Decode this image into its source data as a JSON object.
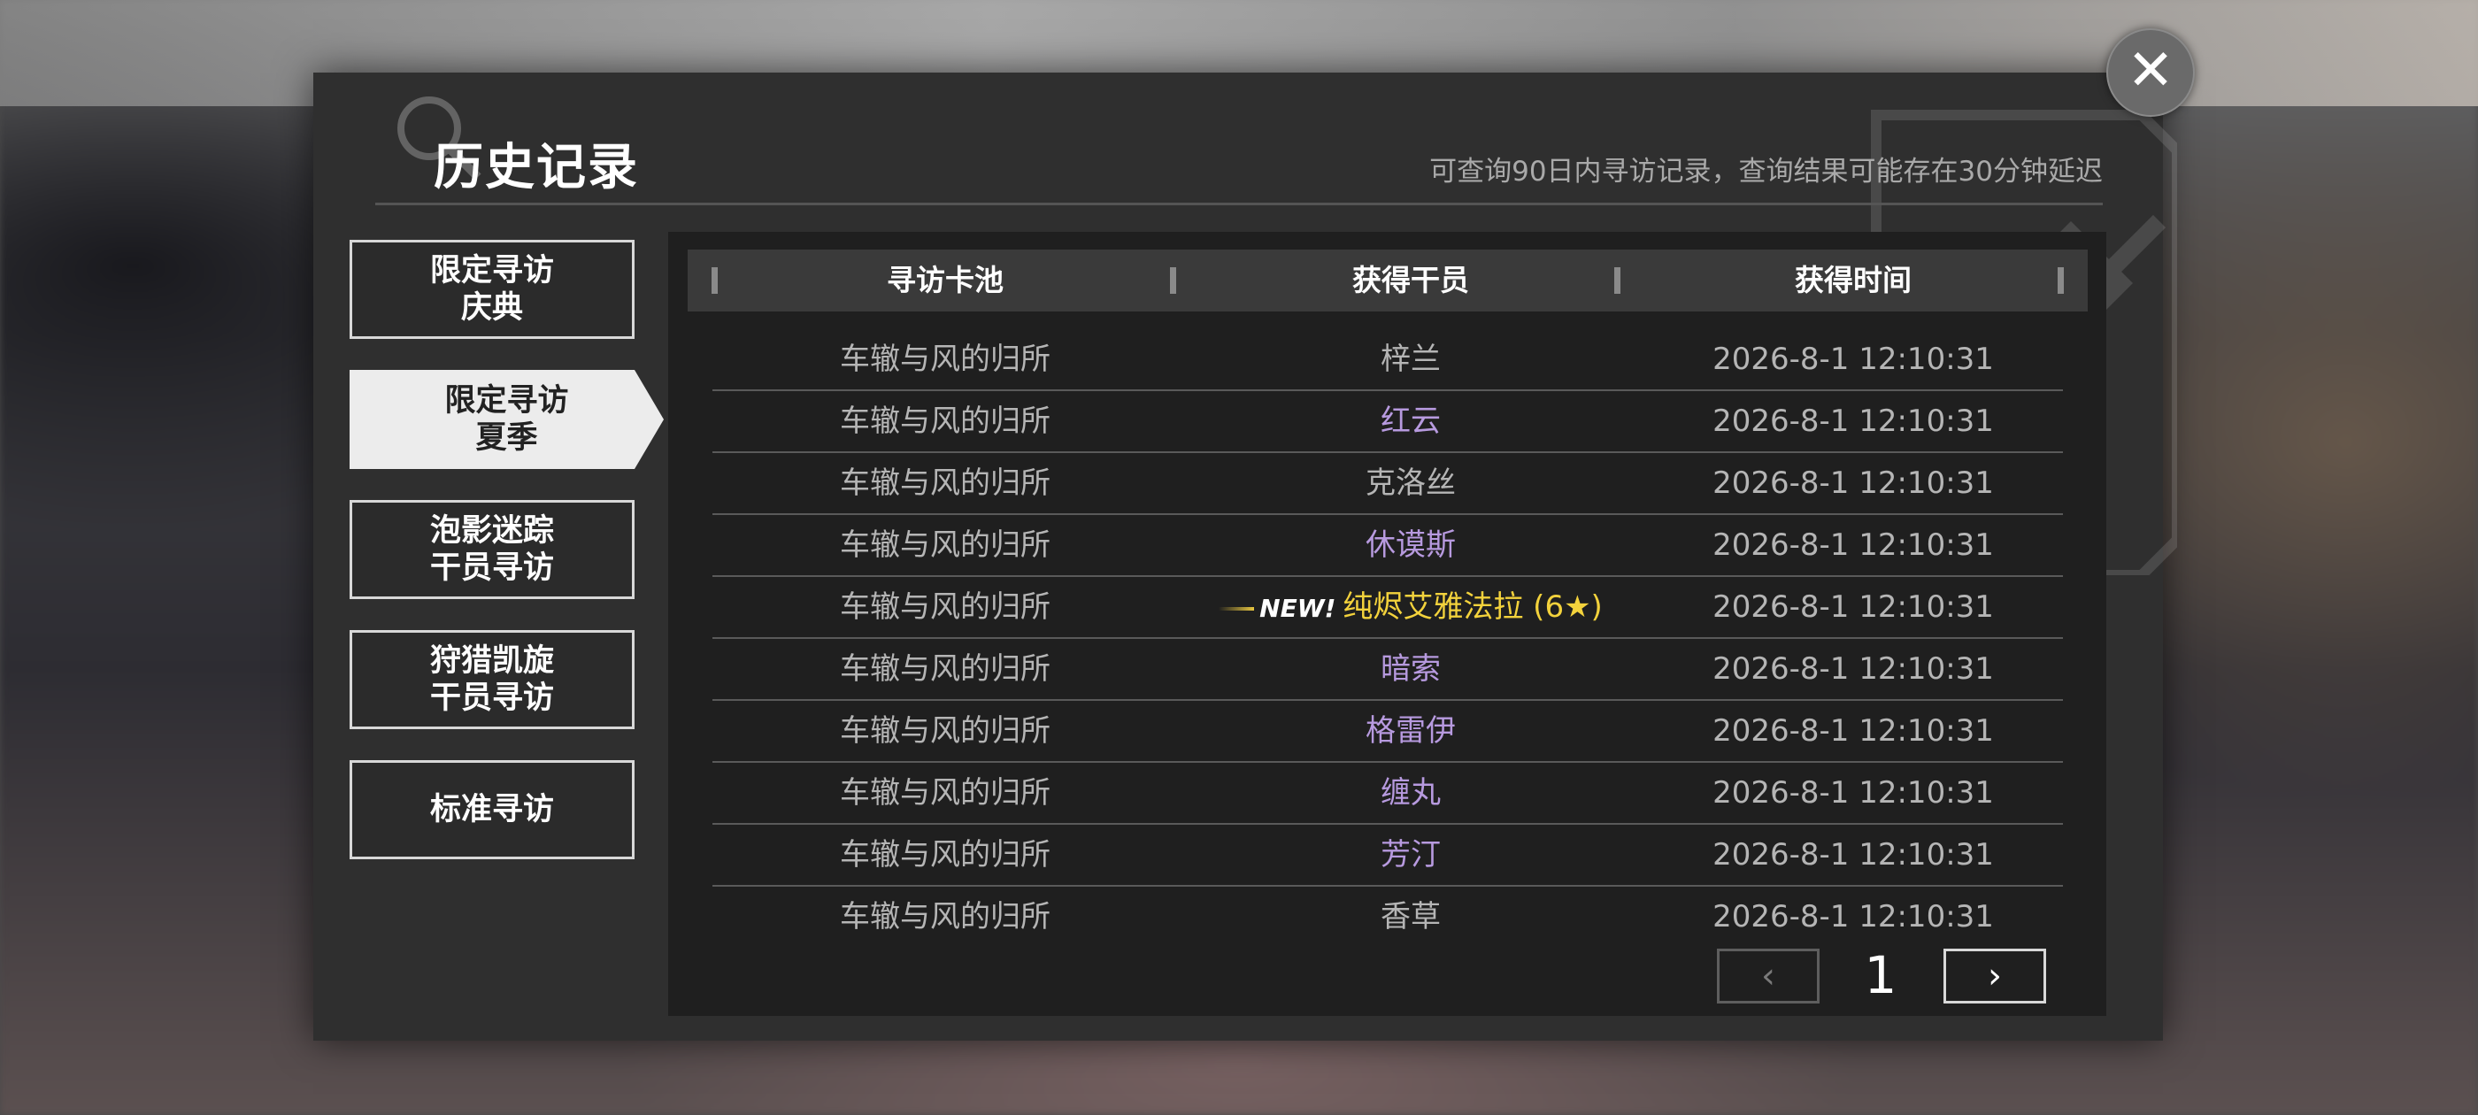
{
  "header": {
    "title": "历史记录",
    "subtitle": "可查询90日内寻访记录，查询结果可能存在30分钟延迟",
    "close_label": "✕"
  },
  "sidebar": {
    "items": [
      {
        "line1": "限定寻访",
        "line2": "庆典",
        "active": false
      },
      {
        "line1": "限定寻访",
        "line2": "夏季",
        "active": true
      },
      {
        "line1": "泡影迷踪",
        "line2": "干员寻访",
        "active": false
      },
      {
        "line1": "狩猎凯旋",
        "line2": "干员寻访",
        "active": false
      },
      {
        "line1": "标准寻访",
        "line2": "",
        "active": false
      }
    ]
  },
  "table": {
    "headers": [
      "寻访卡池",
      "获得干员",
      "获得时间"
    ],
    "new_tag": "NEW!",
    "rows": [
      {
        "pool": "车辙与风的归所",
        "operator": "梓兰",
        "time": "2026-8-1 12:10:31",
        "rarity": "white"
      },
      {
        "pool": "车辙与风的归所",
        "operator": "红云",
        "time": "2026-8-1 12:10:31",
        "rarity": "purple"
      },
      {
        "pool": "车辙与风的归所",
        "operator": "克洛丝",
        "time": "2026-8-1 12:10:31",
        "rarity": "white"
      },
      {
        "pool": "车辙与风的归所",
        "operator": "休谟斯",
        "time": "2026-8-1 12:10:31",
        "rarity": "purple"
      },
      {
        "pool": "车辙与风的归所",
        "operator": "纯烬艾雅法拉 (6★)",
        "time": "2026-8-1 12:10:31",
        "rarity": "gold",
        "is_new": true
      },
      {
        "pool": "车辙与风的归所",
        "operator": "暗索",
        "time": "2026-8-1 12:10:31",
        "rarity": "purple"
      },
      {
        "pool": "车辙与风的归所",
        "operator": "格雷伊",
        "time": "2026-8-1 12:10:31",
        "rarity": "purple"
      },
      {
        "pool": "车辙与风的归所",
        "operator": "缠丸",
        "time": "2026-8-1 12:10:31",
        "rarity": "purple"
      },
      {
        "pool": "车辙与风的归所",
        "operator": "芳汀",
        "time": "2026-8-1 12:10:31",
        "rarity": "purple"
      },
      {
        "pool": "车辙与风的归所",
        "operator": "香草",
        "time": "2026-8-1 12:10:31",
        "rarity": "white"
      }
    ]
  },
  "pagination": {
    "prev_label": "‹",
    "current_page": "1",
    "next_label": "›"
  },
  "colors": {
    "purple": "#b79adf",
    "gold": "#f3d23c",
    "white": "#b5b5b5"
  }
}
